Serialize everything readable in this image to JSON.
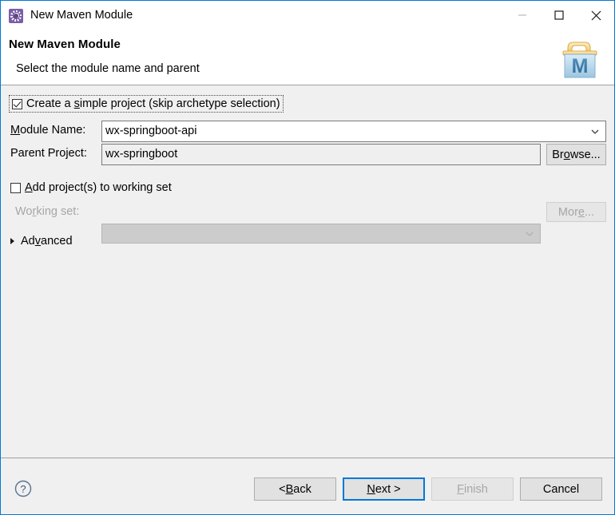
{
  "window": {
    "title": "New Maven Module",
    "icon": "maven-module-icon",
    "controls": {
      "minimize": "minimize-icon",
      "maximize": "maximize-icon",
      "close": "close-icon"
    }
  },
  "header": {
    "title": "New Maven Module",
    "subtitle": "Select the module name and parent",
    "logo": "maven-folder-logo"
  },
  "form": {
    "simple_project": {
      "label_pre": "Create a ",
      "label_mnemonic": "s",
      "label_post": "imple project (skip archetype selection)",
      "checked": true
    },
    "module_name": {
      "label_mnemonic": "M",
      "label_pre": "",
      "label_post": "odule Name:",
      "value": "wx-springboot-api",
      "placeholder": ""
    },
    "parent_project": {
      "label": "Parent Project:",
      "value": "wx-springboot",
      "placeholder": "",
      "browse_pre": "Br",
      "browse_mnemonic": "o",
      "browse_post": "wse..."
    },
    "add_to_working_set": {
      "label_pre": "",
      "label_mnemonic": "A",
      "label_post": "dd project(s) to working set",
      "checked": false
    },
    "working_set": {
      "label_pre": "Wo",
      "label_mnemonic": "r",
      "label_post": "king set:",
      "value": "",
      "more_pre": "Mor",
      "more_mnemonic": "e",
      "more_post": "...",
      "enabled": false
    },
    "advanced": {
      "label_pre": "Ad",
      "label_mnemonic": "v",
      "label_post": "anced",
      "expanded": false
    }
  },
  "footer": {
    "help": "?",
    "back": {
      "pre": "< ",
      "mnemonic": "B",
      "post": "ack"
    },
    "next": {
      "pre": "",
      "mnemonic": "N",
      "post": "ext >"
    },
    "finish": {
      "pre": "",
      "mnemonic": "F",
      "post": "inish",
      "enabled": false
    },
    "cancel": {
      "pre": "Cancel",
      "mnemonic": "",
      "post": ""
    }
  },
  "colors": {
    "accent": "#0078d7",
    "window_bg": "#ffffff",
    "content_bg": "#f0f0f0",
    "button_bg": "#e1e1e1",
    "disabled_text": "#a6a6a6",
    "maven_purple": "#7b5ea7"
  }
}
